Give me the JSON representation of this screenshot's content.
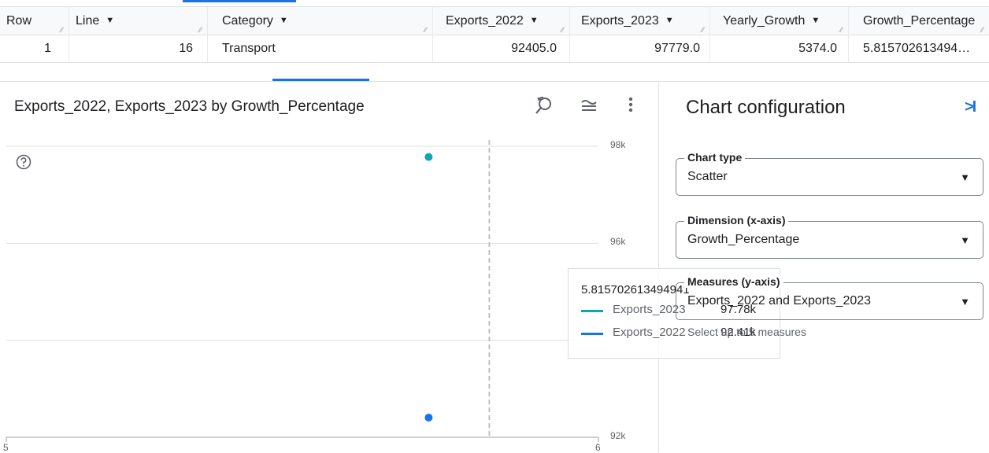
{
  "table": {
    "columns": [
      "Row",
      "Line",
      "Category",
      "Exports_2022",
      "Exports_2023",
      "Yearly_Growth",
      "Growth_Percentage"
    ],
    "rows": [
      [
        "1",
        "16",
        "Transport",
        "92405.0",
        "97779.0",
        "5374.0",
        "5.815702613494…"
      ]
    ]
  },
  "chart": {
    "title": "Exports_2022, Exports_2023 by Growth_Percentage",
    "toolbar": {
      "zoom_icon": "zoom-reset-icon",
      "legend_icon": "legend-icon",
      "more_icon": "more-vert-icon"
    },
    "help_icon": "help-icon"
  },
  "chart_data": {
    "type": "scatter",
    "x_ticks": [
      "5",
      "6"
    ],
    "y_ticks": [
      "92k",
      "96k",
      "98k"
    ],
    "xlim": [
      5,
      6
    ],
    "ylim": [
      92000,
      98000
    ],
    "hover_x": 5.815702613494941,
    "series": [
      {
        "name": "Exports_2023",
        "color": "#12a4af",
        "points": [
          [
            5.815702613494941,
            97779
          ]
        ]
      },
      {
        "name": "Exports_2022",
        "color": "#1a73e8",
        "points": [
          [
            5.815702613494941,
            92405
          ]
        ]
      }
    ]
  },
  "tooltip": {
    "header": "5.815702613494941",
    "items": [
      {
        "name": "Exports_2023",
        "value": "97.78k",
        "color": "#12a4af"
      },
      {
        "name": "Exports_2022",
        "value": "92.41k",
        "color": "#1a73e8"
      }
    ]
  },
  "config": {
    "title": "Chart configuration",
    "collapse_label": ">I",
    "chart_type": {
      "label": "Chart type",
      "value": "Scatter"
    },
    "dimension": {
      "label": "Dimension (x-axis)",
      "value": "Growth_Percentage"
    },
    "measures": {
      "label": "Measures (y-axis)",
      "value": "Exports_2022 and Exports_2023",
      "hint": "Select up to 5 measures"
    }
  }
}
